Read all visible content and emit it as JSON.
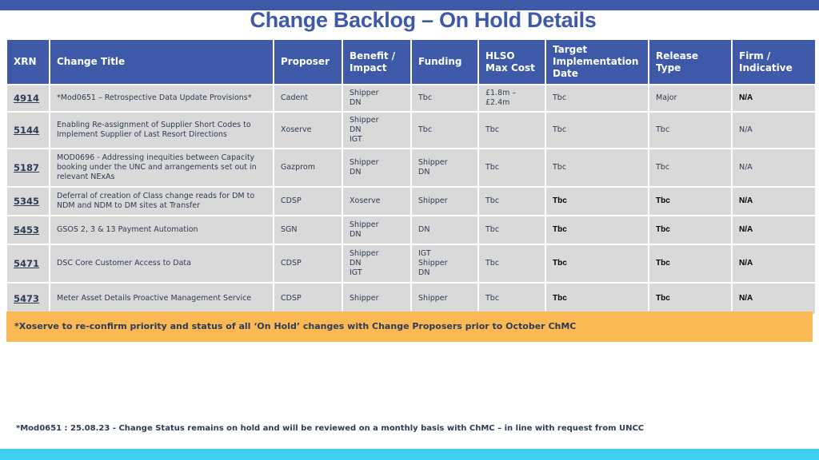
{
  "title": "Change Backlog – On Hold Details",
  "table": {
    "headers": [
      "XRN",
      "Change Title",
      "Proposer",
      "Benefit / Impact",
      "Funding",
      "HLSO Max Cost",
      "Target Implementation Date",
      "Release Type",
      "Firm / Indicative"
    ],
    "rows": [
      {
        "xrn": "4914",
        "title": "*Mod0651 – Retrospective Data Update Provisions*",
        "proposer": "Cadent",
        "benefit": [
          "Shipper",
          "DN"
        ],
        "funding": [
          "Tbc"
        ],
        "cost": [
          "£1.8m –",
          "£2.4m"
        ],
        "target": "Tbc",
        "release": "Major",
        "firm": "N/A"
      },
      {
        "xrn": "5144",
        "title": "Enabling Re-assignment of Supplier Short Codes to Implement Supplier of Last Resort Directions",
        "proposer": "Xoserve",
        "benefit": [
          "Shipper",
          "DN",
          "IGT"
        ],
        "funding": [
          "Tbc"
        ],
        "cost": [
          "Tbc"
        ],
        "target": "Tbc",
        "release": "Tbc",
        "firm": "N/A"
      },
      {
        "xrn": "5187",
        "title": "MOD0696 - Addressing inequities between Capacity booking under the UNC and arrangements set out in relevant NExAs",
        "proposer": "Gazprom",
        "benefit": [
          "Shipper",
          "DN"
        ],
        "funding": [
          "Shipper",
          "DN"
        ],
        "cost": [
          "Tbc"
        ],
        "target": "Tbc",
        "release": "Tbc",
        "firm": "N/A"
      },
      {
        "xrn": "5345",
        "title": "Deferral of creation of Class change reads for DM to NDM and NDM to DM sites at Transfer",
        "proposer": "CDSP",
        "benefit": [
          "Xoserve"
        ],
        "funding": [
          "Shipper"
        ],
        "cost": [
          "Tbc"
        ],
        "target": "Tbc",
        "release": "Tbc",
        "firm": "N/A"
      },
      {
        "xrn": "5453",
        "title": "GSOS 2, 3 & 13 Payment Automation",
        "proposer": "SGN",
        "benefit": [
          "Shipper",
          "DN"
        ],
        "funding": [
          "DN"
        ],
        "cost": [
          "Tbc"
        ],
        "target": "Tbc",
        "release": "Tbc",
        "firm": "N/A"
      },
      {
        "xrn": "5471",
        "title": "DSC Core Customer Access to Data",
        "proposer": "CDSP",
        "benefit": [
          "Shipper",
          "DN",
          "IGT"
        ],
        "funding": [
          "IGT",
          "Shipper",
          "DN"
        ],
        "cost": [
          "Tbc"
        ],
        "target": "Tbc",
        "release": "Tbc",
        "firm": "N/A"
      },
      {
        "xrn": "5473",
        "title": "Meter Asset Details Proactive Management Service",
        "proposer": "CDSP",
        "benefit": [
          "Shipper"
        ],
        "funding": [
          "Shipper"
        ],
        "cost": [
          "Tbc"
        ],
        "target": "Tbc",
        "release": "Tbc",
        "firm": "N/A"
      }
    ]
  },
  "banner": "*Xoserve to re-confirm priority and status of all ‘On Hold’ changes with Change Proposers prior to October ChMC",
  "footnote": "*Mod0651 : 25.08.23 - Change Status remains on hold and will be reviewed on a monthly basis with ChMC – in line with request from UNCC",
  "colors": {
    "header": "#3e59a8",
    "cell": "#d9d9d9",
    "banner": "#fbb955",
    "bottom_bar": "#3ecff0"
  }
}
